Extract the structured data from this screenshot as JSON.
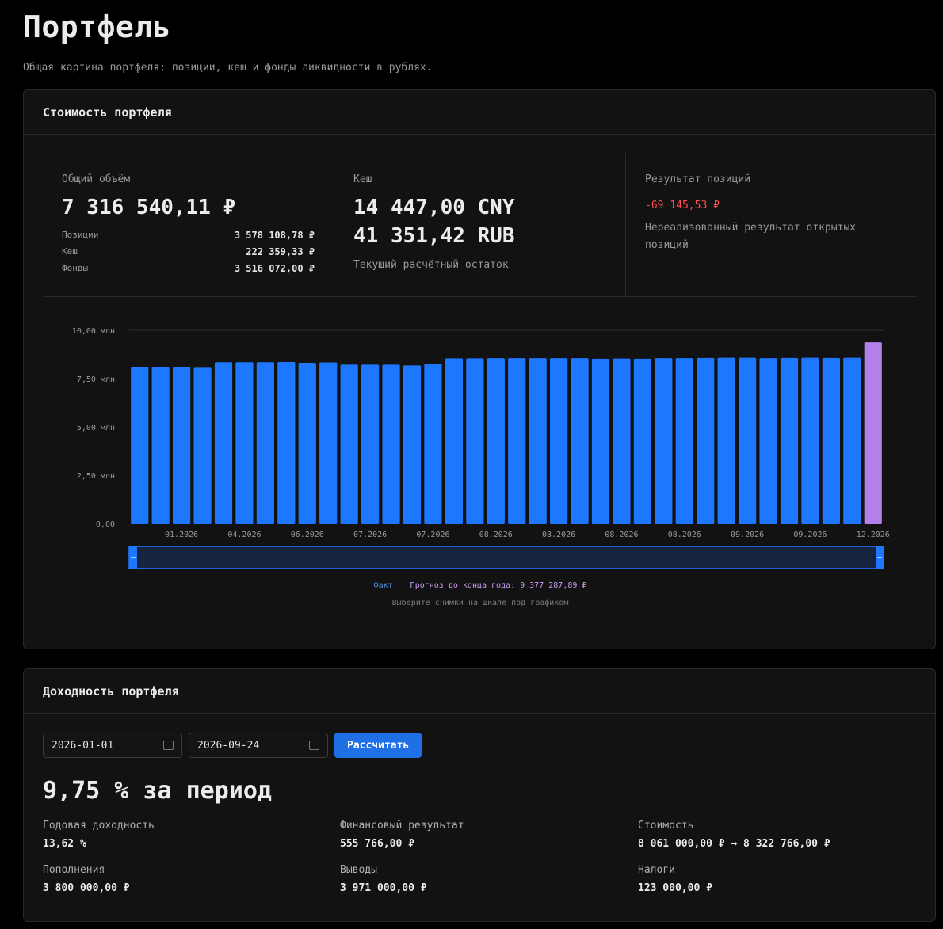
{
  "page": {
    "title": "Портфель",
    "subtitle": "Общая картина портфеля: позиции, кеш и фонды ликвидности в рублях."
  },
  "value_card": {
    "title": "Стоимость портфеля",
    "total": {
      "label": "Общий объём",
      "value": "7 316 540,11 ₽",
      "rows": [
        {
          "label": "Позиции",
          "value": "3 578 108,78 ₽"
        },
        {
          "label": "Кеш",
          "value": "222 359,33 ₽"
        },
        {
          "label": "Фонды",
          "value": "3 516 072,00 ₽"
        }
      ]
    },
    "cash": {
      "label": "Кеш",
      "values": [
        "14 447,00 CNY",
        "41 351,42 RUB"
      ],
      "note": "Текущий расчётный остаток"
    },
    "result": {
      "label": "Результат позиций",
      "value": "-69 145,53 ₽",
      "note_line1": "Нереализованный результат открытых",
      "note_line2": "позиций"
    },
    "legend": {
      "fact": "Факт",
      "forecast": "Прогноз до конца года: 9 377 287,89 ₽",
      "hint": "Выберите снимки на шкале под графиком"
    }
  },
  "chart_data": {
    "type": "bar",
    "y_tick_labels": [
      "0,00",
      "2,50 млн",
      "5,00 млн",
      "7,50 млн",
      "10,00 млн"
    ],
    "y_ticks": [
      0,
      2.5,
      5.0,
      7.5,
      10.0
    ],
    "ylim": [
      0,
      10.0
    ],
    "x_tick_labels": [
      "01.2026",
      "04.2026",
      "06.2026",
      "07.2026",
      "07.2026",
      "08.2026",
      "08.2026",
      "08.2026",
      "08.2026",
      "09.2026",
      "09.2026",
      "12.2026"
    ],
    "x_tick_bar_index": [
      2,
      5,
      8,
      11,
      14,
      17,
      20,
      23,
      26,
      29,
      32,
      35
    ],
    "values": [
      8.08,
      8.08,
      8.08,
      8.06,
      8.35,
      8.35,
      8.35,
      8.36,
      8.32,
      8.34,
      8.22,
      8.22,
      8.22,
      8.18,
      8.26,
      8.55,
      8.55,
      8.56,
      8.56,
      8.56,
      8.56,
      8.56,
      8.53,
      8.54,
      8.53,
      8.56,
      8.56,
      8.57,
      8.58,
      8.58,
      8.56,
      8.57,
      8.58,
      8.57,
      8.58,
      9.38
    ],
    "series_colors": {
      "fact": "#1e78ff",
      "forecast": "#b57fe8"
    },
    "forecast_index": 35,
    "grid": true
  },
  "returns_card": {
    "title": "Доходность портфеля",
    "date_from": "2026-01-01",
    "date_to": "2026-09-24",
    "calc_label": "Рассчитать",
    "period_result": "9,75 % за период",
    "metrics": [
      {
        "label": "Годовая доходность",
        "value": "13,62 %"
      },
      {
        "label": "Финансовый результат",
        "value": "555 766,00 ₽"
      },
      {
        "label": "Стоимость",
        "value": "8 061 000,00 ₽ → 8 322 766,00 ₽"
      },
      {
        "label": "Пополнения",
        "value": "3 800 000,00 ₽"
      },
      {
        "label": "Выводы",
        "value": "3 971 000,00 ₽"
      },
      {
        "label": "Налоги",
        "value": "123 000,00 ₽"
      }
    ]
  },
  "colors": {
    "accent": "#1f6fe5",
    "negative": "#ff4d4f",
    "bar": "#1e78ff",
    "forecast_bar": "#b57fe8"
  }
}
